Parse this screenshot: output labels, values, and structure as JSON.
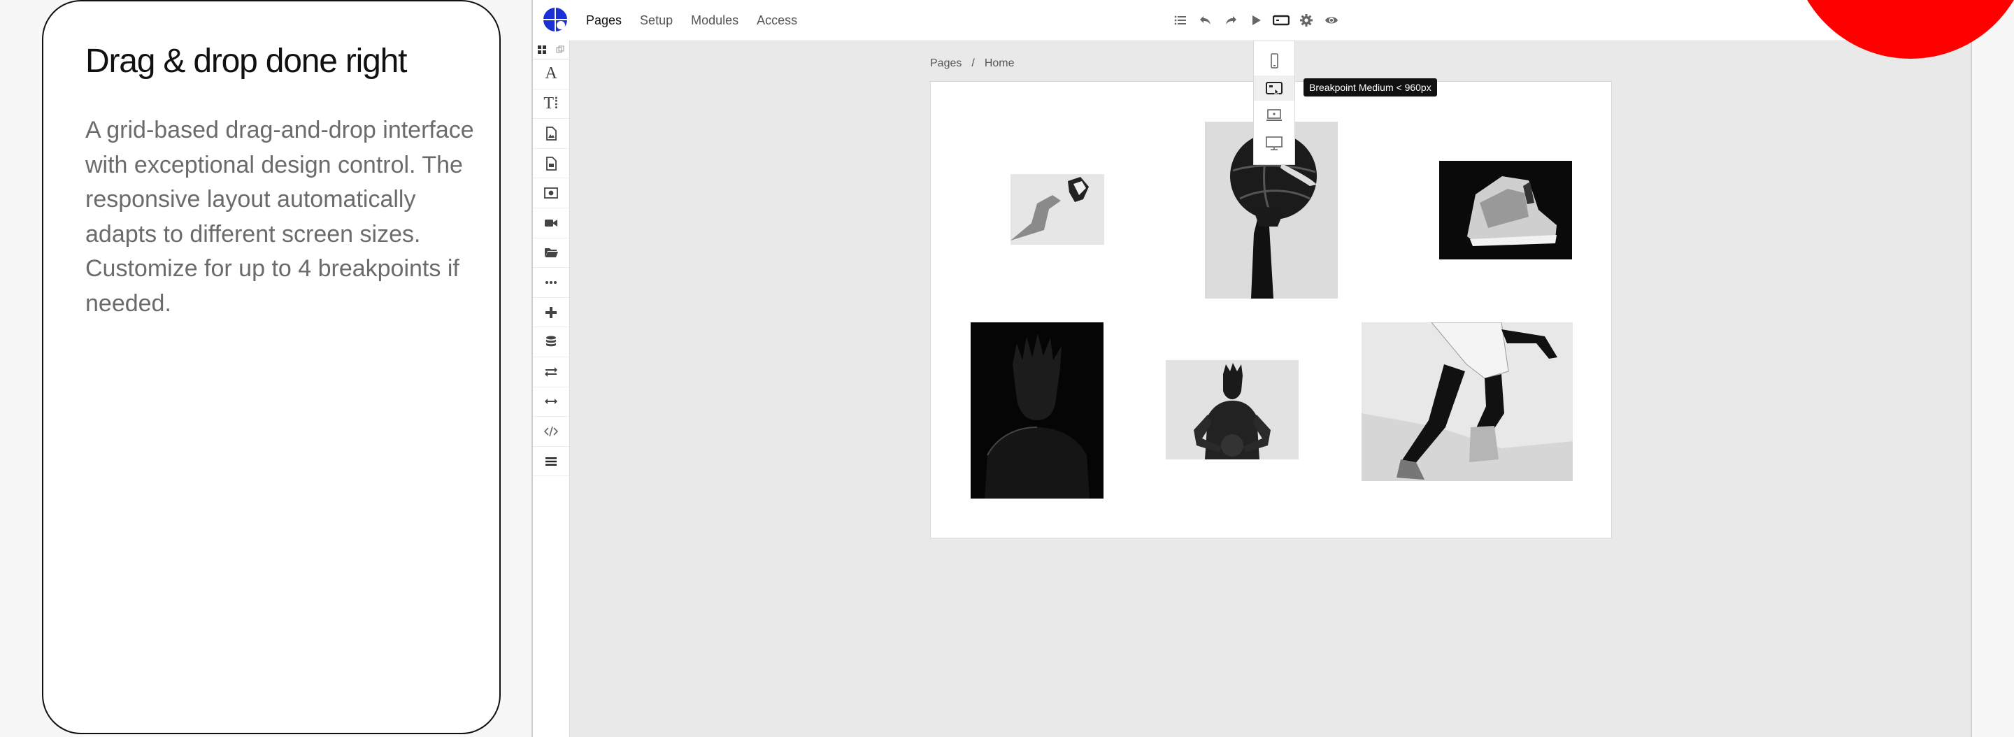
{
  "card": {
    "title": "Drag & drop done right",
    "body": "A grid-based drag-and-drop interface with exceptional design control. The responsive layout automatically adapts to different screen sizes. Customize for up to 4 breakpoints if needed."
  },
  "nav": {
    "items": [
      "Pages",
      "Setup",
      "Modules",
      "Access"
    ],
    "active": "Pages"
  },
  "toolbar": {
    "icons": [
      "list-icon",
      "undo-icon",
      "redo-icon",
      "play-icon",
      "breakpoint-icon",
      "gear-icon",
      "eye-icon"
    ]
  },
  "breadcrumb": {
    "root": "Pages",
    "separator": "/",
    "current": "Home"
  },
  "breakpoints": {
    "options": [
      "mobile-icon",
      "tablet-icon",
      "laptop-icon",
      "desktop-icon"
    ],
    "selected": "tablet-icon",
    "tooltip": "Breakpoint Medium < 960px"
  },
  "colors": {
    "brand": "#1a2fd6",
    "accent": "#ff0000",
    "tooltip_bg": "#111111"
  }
}
